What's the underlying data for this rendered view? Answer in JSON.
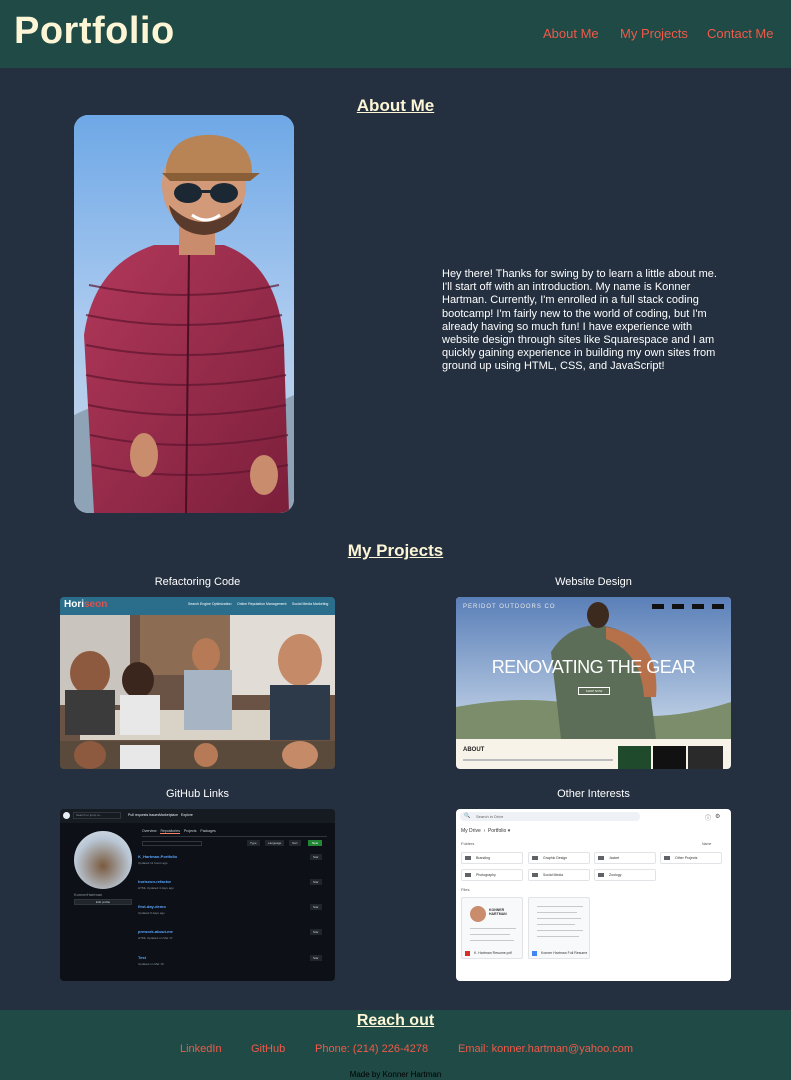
{
  "header": {
    "brand": "Portfolio",
    "nav": [
      "About Me",
      "My Projects",
      "Contact Me"
    ]
  },
  "about": {
    "title": "About Me",
    "text": "Hey there! Thanks for swing by to learn a little about me. I'll start off with an introduction. My name is Konner Hartman. Currently, I'm enrolled in a full stack coding bootcamp! I'm fairly new to the world of coding, but I'm already having so much fun! I have experience with website design through sites like Squarespace and I am quickly gaining experience in building my own sites from ground up using HTML, CSS, and JavaScript!"
  },
  "projects": {
    "title": "My Projects",
    "items": [
      {
        "label": "Refactoring Code",
        "thumb": {
          "logo": "Hori",
          "logo_accent": "seon",
          "nav": [
            "Search Engine Optimization",
            "Online Reputation Management",
            "Social Media Marketing"
          ]
        }
      },
      {
        "label": "Website Design",
        "thumb": {
          "brand": "PERIDOT OUTDOORS CO",
          "headline": "RENOVATING THE GEAR",
          "button": "SHOP NOW",
          "section": "ABOUT"
        }
      },
      {
        "label": "GitHub Links",
        "thumb": {
          "search": "Search or jump to...",
          "nav": [
            "Pull requests",
            "Issues",
            "Marketplace",
            "Explore"
          ],
          "tabs": [
            "Overview",
            "Repositories",
            "Projects",
            "Packages"
          ],
          "username": "KonnerHartman",
          "edit": "Edit profile",
          "filters": [
            "Type",
            "Language",
            "Sort"
          ],
          "new": "New",
          "repos": [
            {
              "name": "K_Hartman-Portfolio",
              "meta": "Updated 11 hours ago"
            },
            {
              "name": "horiseon-refactor",
              "meta": "HTML   Updated 4 days ago"
            },
            {
              "name": "first-day-demo",
              "meta": "Updated 9 days ago"
            },
            {
              "name": "prework-about-me",
              "meta": "HTML   Updated on Mar 17"
            },
            {
              "name": "Test",
              "meta": "Updated on Mar 15"
            }
          ],
          "star": "Star"
        }
      },
      {
        "label": "Other Interests",
        "thumb": {
          "search": "Search in Drive",
          "crumbs": [
            "My Drive",
            "Portfolio"
          ],
          "folders_label": "Folders",
          "name_sort": "Name",
          "folders": [
            "Branding",
            "Graphic Design",
            "Jacket",
            "Other Projects",
            "Photography",
            "Social Media",
            "Zoology"
          ],
          "files_label": "Files",
          "files": [
            "K. Hartman Resume.pdf",
            "Konner Hartman Full Resume"
          ],
          "resume_name": "KONNER HARTMAN"
        }
      }
    ]
  },
  "reach": {
    "title": "Reach out",
    "links": [
      "LinkedIn",
      "GitHub",
      "Phone: (214) 226-4278",
      "Email: konner.hartman@yahoo.com"
    ],
    "made_by": "Made by Konner Hartman"
  },
  "colors": {
    "page_bg": "#24303f",
    "header_bg": "#1f4a45",
    "heading": "#fdf6d6",
    "link": "#f05a4a"
  }
}
